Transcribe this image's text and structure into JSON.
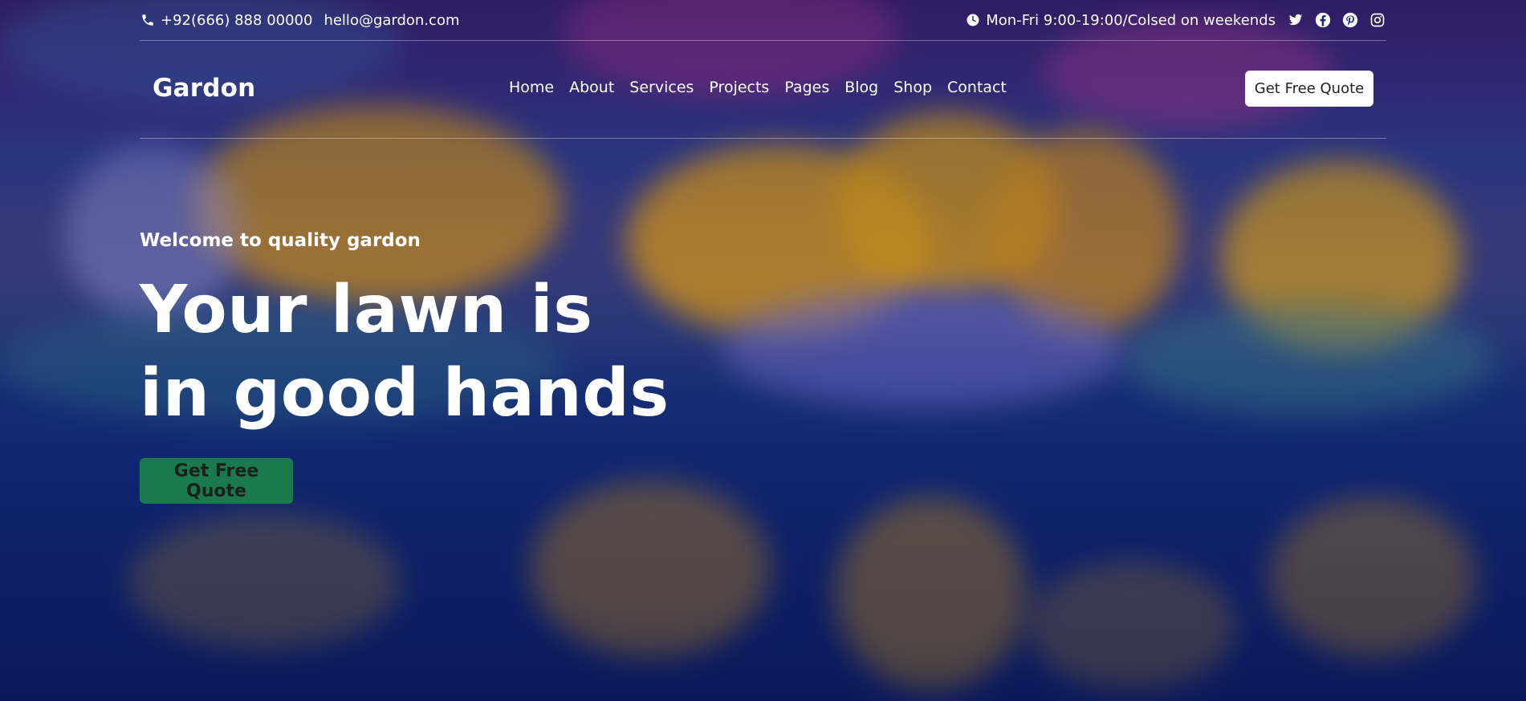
{
  "topbar": {
    "phone": "+92(666) 888 00000",
    "email": "hello@gardon.com",
    "hours": "Mon-Fri 9:00-19:00/Colsed on weekends",
    "social_icons": [
      "twitter-icon",
      "facebook-icon",
      "pinterest-icon",
      "instagram-icon"
    ]
  },
  "nav": {
    "brand": "Gardon",
    "items": [
      "Home",
      "About",
      "Services",
      "Projects",
      "Pages",
      "Blog",
      "Shop",
      "Contact"
    ],
    "quote_button": "Get Free Quote"
  },
  "hero": {
    "welcome": "Welcome to quality gardon",
    "headline_line1": "Your lawn is",
    "headline_line2": "in good hands",
    "cta_button": "Get Free Quote"
  },
  "colors": {
    "cta_bg": "#1b7a4d",
    "quote_bg": "#ffffff",
    "overlay": "#0d1a5c"
  }
}
